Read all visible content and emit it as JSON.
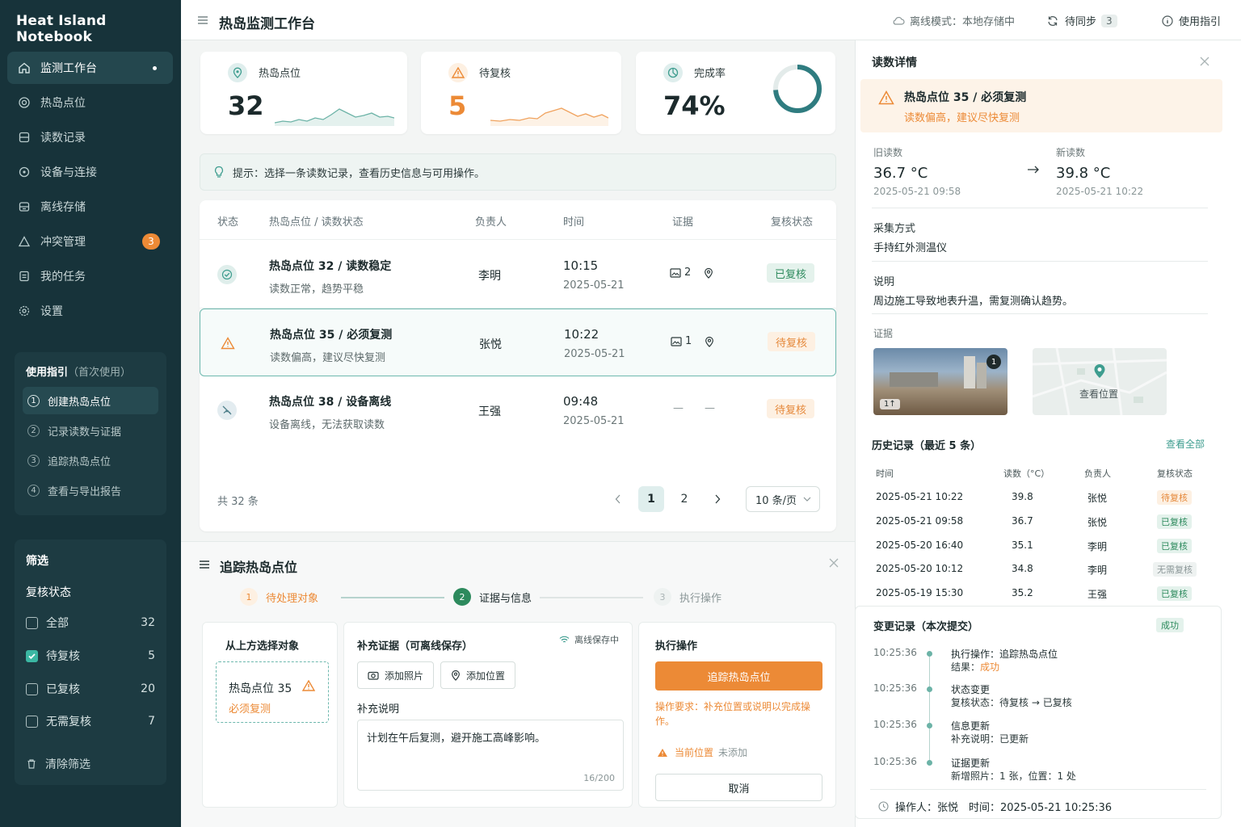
{
  "app": {
    "name": "Heat Island Notebook",
    "page_title": "热岛监测工作台"
  },
  "topbar": {
    "offline": "离线模式：本地存储中",
    "sync_label": "待同步",
    "sync_count": "3",
    "guide": "使用指引"
  },
  "sidebar": {
    "items": [
      {
        "label": "监测工作台",
        "icon": "home-icon"
      },
      {
        "label": "热岛点位",
        "icon": "target-icon"
      },
      {
        "label": "读数记录",
        "icon": "database-icon"
      },
      {
        "label": "设备与连接",
        "icon": "device-icon"
      },
      {
        "label": "离线存储",
        "icon": "storage-icon"
      },
      {
        "label": "冲突管理",
        "icon": "warning-icon",
        "badge": "3"
      },
      {
        "label": "我的任务",
        "icon": "task-icon"
      },
      {
        "label": "设置",
        "icon": "gear-icon"
      }
    ],
    "guide": {
      "title": "使用指引",
      "subtitle": "（首次使用）",
      "steps": [
        "创建热岛点位",
        "记录读数与证据",
        "追踪热岛点位",
        "查看与导出报告"
      ],
      "step_nums": [
        "1",
        "2",
        "3",
        "4"
      ]
    },
    "filter": {
      "title": "筛选",
      "section": "复核状态",
      "options": [
        {
          "label": "全部",
          "count": "32",
          "checked": false
        },
        {
          "label": "待复核",
          "count": "5",
          "checked": true
        },
        {
          "label": "已复核",
          "count": "20",
          "checked": false
        },
        {
          "label": "无需复核",
          "count": "7",
          "checked": false
        }
      ],
      "clear": "清除筛选"
    }
  },
  "stats": [
    {
      "label": "热岛点位",
      "value": "32",
      "color": "#5aa89b"
    },
    {
      "label": "待复核",
      "value": "5",
      "color": "#ec8a36"
    },
    {
      "label": "完成率",
      "value": "74%",
      "progress": 0.74,
      "color": "#2f7c80"
    }
  ],
  "hint": "提示：选择一条读数记录，查看历史信息与可用操作。",
  "table": {
    "headers": [
      "状态",
      "热岛点位 / 读数状态",
      "负责人",
      "时间",
      "证据",
      "复核状态"
    ],
    "rows": [
      {
        "title": "热岛点位 32 / 读数稳定",
        "sub": "读数正常，趋势平稳",
        "owner": "李明",
        "time": "10:15",
        "date": "2025-05-21",
        "photos": "2",
        "status": "已复核",
        "kind": "ok"
      },
      {
        "title": "热岛点位 35 / 必须复测",
        "sub": "读数偏高，建议尽快复测",
        "owner": "张悦",
        "time": "10:22",
        "date": "2025-05-21",
        "photos": "1",
        "status": "待复核",
        "kind": "warn"
      },
      {
        "title": "热岛点位 38 / 设备离线",
        "sub": "设备离线，无法获取读数",
        "owner": "王强",
        "time": "09:48",
        "date": "2025-05-21",
        "photos": "—",
        "status": "待复核",
        "kind": "offline"
      }
    ],
    "total": "共 32 条",
    "pages": [
      "1",
      "2"
    ],
    "page_size": "10 条/页"
  },
  "track": {
    "title": "追踪热岛点位",
    "steps": [
      {
        "num": "1",
        "label": "待处理对象"
      },
      {
        "num": "2",
        "label": "证据与信息"
      },
      {
        "num": "3",
        "label": "执行操作"
      }
    ],
    "select_title": "从上方选择对象",
    "selected_name": "热岛点位 35",
    "selected_status": "必须复测",
    "evidence_title": "补充证据（可离线保存）",
    "offline_save": "离线保存中",
    "add_photo": "添加照片",
    "add_location": "添加位置",
    "note_label": "补充说明",
    "note_text": "计划在午后复测，避开施工高峰影响。",
    "note_count": "16/200",
    "action_title": "执行操作",
    "action_button": "追踪热岛点位",
    "requirement": "操作要求：补充位置或说明以完成操作。",
    "current_location": "当前位置",
    "not_added": "未添加",
    "cancel": "取消"
  },
  "detail": {
    "title": "读数详情",
    "alert_title": "热岛点位 35 / 必须复测",
    "alert_sub": "读数偏高，建议尽快复测",
    "old_label": "旧读数",
    "old_value": "36.7 °C",
    "old_time": "2025-05-21 09:58",
    "new_label": "新读数",
    "new_value": "39.8 °C",
    "new_time": "2025-05-21 10:22",
    "method_label": "采集方式",
    "method": "手持红外测温仪",
    "note_label": "说明",
    "note": "周边施工导致地表升温，需复测确认趋势。",
    "evidence_label": "证据",
    "photo_count": "1",
    "photo_overlay": "1↑",
    "view_location": "查看位置",
    "history_title": "历史记录（最近 5 条）",
    "view_all": "查看全部",
    "history_headers": [
      "时间",
      "读数（°C）",
      "负责人",
      "复核状态"
    ],
    "history": [
      {
        "time": "2025-05-21 10:22",
        "value": "39.8",
        "owner": "张悦",
        "status": "待复核",
        "kind": "wait"
      },
      {
        "time": "2025-05-21 09:58",
        "value": "36.7",
        "owner": "张悦",
        "status": "已复核",
        "kind": "ok"
      },
      {
        "time": "2025-05-20 16:40",
        "value": "35.1",
        "owner": "李明",
        "status": "已复核",
        "kind": "ok"
      },
      {
        "time": "2025-05-20 10:12",
        "value": "34.8",
        "owner": "李明",
        "status": "无需复核",
        "kind": "none"
      },
      {
        "time": "2025-05-19 15:30",
        "value": "35.2",
        "owner": "王强",
        "status": "已复核",
        "kind": "ok"
      }
    ],
    "changes_title": "变更记录（本次提交）",
    "changes_status": "成功",
    "changes": [
      {
        "time": "10:25:36",
        "a": "执行操作：追踪热岛点位",
        "b_label": "结果：",
        "b_value": "成功"
      },
      {
        "time": "10:25:36",
        "a": "状态变更",
        "b_label": "复核状态：",
        "b_value": "待复核 → 已复核"
      },
      {
        "time": "10:25:36",
        "a": "信息更新",
        "b_label": "补充说明：",
        "b_value": "已更新"
      },
      {
        "time": "10:25:36",
        "a": "证据更新",
        "b_label": "新增照片：",
        "b_value": "1 张，位置：1 处"
      }
    ],
    "footer": "操作人：张悦　时间：2025-05-21 10:25:36"
  }
}
